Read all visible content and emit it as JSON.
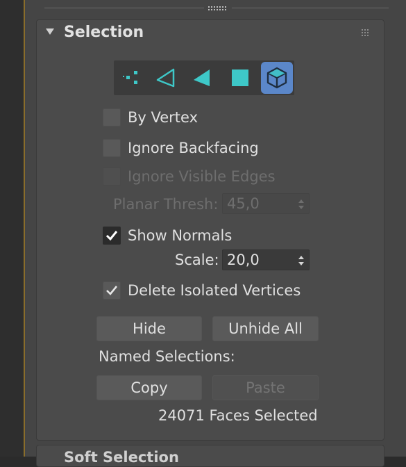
{
  "rollout": {
    "title": "Selection",
    "next_title": "Soft Selection"
  },
  "subobject_levels": [
    {
      "name": "vertex",
      "icon": "vertex-dots-icon",
      "active": false
    },
    {
      "name": "edge",
      "icon": "triangle-outline-icon",
      "active": false
    },
    {
      "name": "face",
      "icon": "triangle-filled-icon",
      "active": false
    },
    {
      "name": "polygon",
      "icon": "square-filled-icon",
      "active": false
    },
    {
      "name": "element",
      "icon": "cube-icon",
      "active": true
    }
  ],
  "options": {
    "by_vertex": {
      "label": "By Vertex",
      "checked": false
    },
    "ignore_backfacing": {
      "label": "Ignore Backfacing",
      "checked": false
    },
    "ignore_visible_edges": {
      "label": "Ignore Visible Edges",
      "checked": false,
      "enabled": false
    },
    "planar_thresh": {
      "label": "Planar Thresh:",
      "value": "45,0",
      "enabled": false
    },
    "show_normals": {
      "label": "Show Normals",
      "checked": true
    },
    "scale": {
      "label": "Scale:",
      "value": "20,0"
    },
    "delete_isolated": {
      "label": "Delete Isolated Vertices",
      "checked": true
    }
  },
  "buttons": {
    "hide": "Hide",
    "unhide_all": "Unhide All",
    "copy": "Copy",
    "paste": "Paste"
  },
  "named_selections_label": "Named Selections:",
  "status": "24071 Faces Selected",
  "colors": {
    "accent": "#3ec8c8",
    "active_button": "#5b87c9",
    "panel": "#4b4b4b"
  }
}
